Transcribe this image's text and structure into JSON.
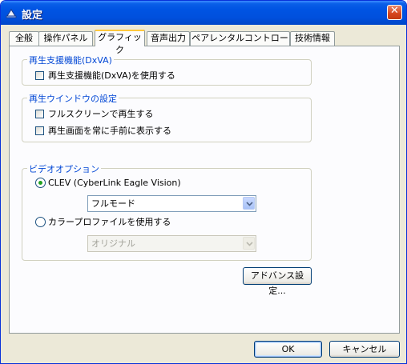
{
  "window": {
    "title": "設定"
  },
  "tabs": [
    {
      "label": "全般"
    },
    {
      "label": "操作パネル"
    },
    {
      "label": "グラフィック"
    },
    {
      "label": "音声出力"
    },
    {
      "label": "ペアレンタルコントロール"
    },
    {
      "label": "技術情報"
    }
  ],
  "groups": {
    "dxva": {
      "title": "再生支援機能(DxVA)",
      "checkbox_label": "再生支援機能(DxVA)を使用する",
      "checked": false
    },
    "playback_window": {
      "title": "再生ウインドウの設定",
      "fullscreen_label": "フルスクリーンで再生する",
      "fullscreen_checked": false,
      "ontop_label": "再生画面を常に手前に表示する",
      "ontop_checked": false
    },
    "video_options": {
      "title": "ビデオオプション",
      "clev_label": "CLEV (CyberLink Eagle Vision)",
      "clev_selected": true,
      "clev_mode_value": "フルモード",
      "color_profile_label": "カラープロファイルを使用する",
      "color_profile_selected": false,
      "color_profile_value": "オリジナル"
    }
  },
  "advanced_button": "アドバンス設定...",
  "footer": {
    "ok_label": "OK",
    "cancel_label": "キャンセル"
  },
  "colors": {
    "title_bar": "#0054e3",
    "group_title": "#0046d5",
    "active_tab_accent": "#ffc83c",
    "radio_dot": "#21a121"
  }
}
